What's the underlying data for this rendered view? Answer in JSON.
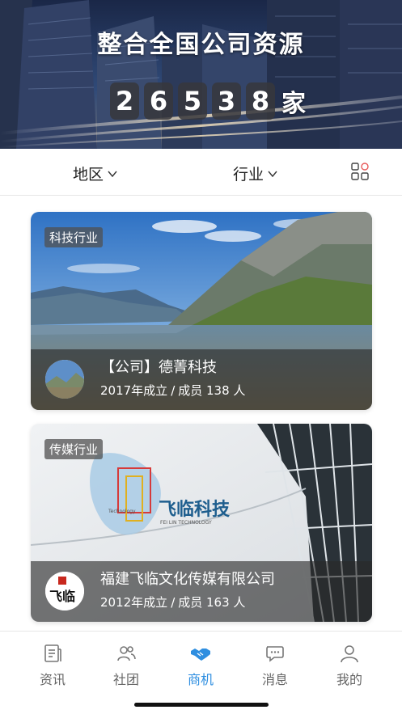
{
  "hero": {
    "title": "整合全国公司资源",
    "digits": [
      "2",
      "6",
      "5",
      "3",
      "8"
    ],
    "unit": "家"
  },
  "filters": {
    "region": "地区",
    "industry": "行业"
  },
  "companies": [
    {
      "tag": "科技行业",
      "name": "【公司】德菁科技",
      "year": "2017年成立",
      "members": "成员 138 人"
    },
    {
      "tag": "传媒行业",
      "name": "福建飞临文化传媒有限公司",
      "year": "2012年成立",
      "members": "成员 163 人"
    }
  ],
  "card2_sign": {
    "brand": "飞临科技",
    "sub": "FEI LIN TECHNOLOGY",
    "small": "Technology"
  },
  "card2_logo_text": "飞临",
  "tabs": [
    {
      "label": "资讯",
      "icon": "news-icon"
    },
    {
      "label": "社团",
      "icon": "community-icon"
    },
    {
      "label": "商机",
      "icon": "handshake-icon"
    },
    {
      "label": "消息",
      "icon": "message-icon"
    },
    {
      "label": "我的",
      "icon": "profile-icon"
    }
  ],
  "active_tab": "商机",
  "colors": {
    "accent": "#2e8ee0",
    "tab_inactive": "#666666",
    "grid_icon_accent": "#e85a5a"
  }
}
